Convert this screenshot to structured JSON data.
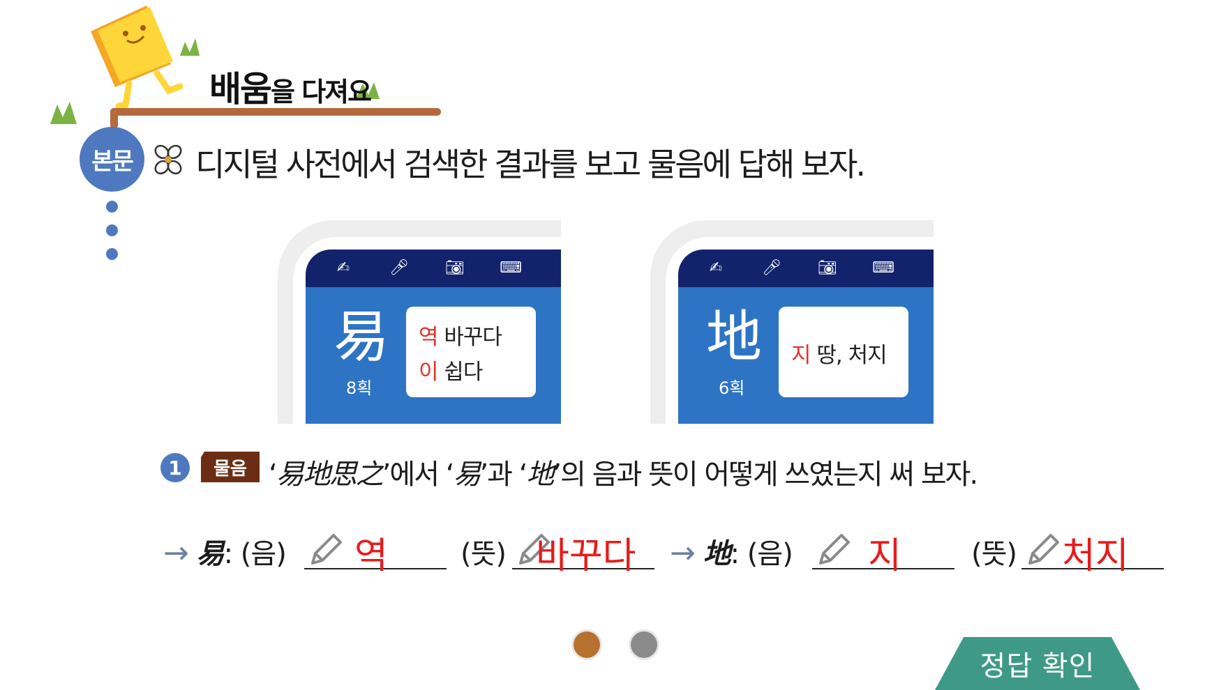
{
  "header": {
    "title_main": "배움",
    "title_rest": "을 다져요"
  },
  "section": {
    "badge": "본문",
    "instruction": "디지털 사전에서 검색한 결과를 보고 물음에 답해 보자."
  },
  "dictionary_cards": [
    {
      "hanja": "易",
      "strokes": "8획",
      "readings": [
        {
          "sound": "역",
          "meaning": "바꾸다"
        },
        {
          "sound": "이",
          "meaning": "쉽다"
        }
      ]
    },
    {
      "hanja": "地",
      "strokes": "6획",
      "readings": [
        {
          "sound": "지",
          "meaning": "땅, 처지"
        }
      ]
    }
  ],
  "question": {
    "number": "1",
    "tag": "물음",
    "text_q1": "‘",
    "text_phrase": "易地思之",
    "text_q2": "’에서 ‘",
    "text_c1": "易",
    "text_q3": "’과 ‘",
    "text_c2": "地",
    "text_q4": "’의 음과 뜻이 어떻게 쓰였는지 써 보자."
  },
  "answers": {
    "arrow": "→",
    "items": [
      {
        "char": "易",
        "sound_label": "(음)",
        "sound": "역",
        "meaning_label": "(뜻)",
        "meaning": "바꾸다"
      },
      {
        "char": "地",
        "sound_label": "(음)",
        "sound": "지",
        "meaning_label": "(뜻)",
        "meaning": "처지"
      }
    ]
  },
  "pagination": {
    "total": 2,
    "current": 1,
    "active_color": "#b8702e",
    "inactive_color": "#8a8a8a"
  },
  "check_button": {
    "label": "정답 확인"
  },
  "colors": {
    "accent_blue": "#4e79c0",
    "answer_red": "#e81b1b",
    "banner_brown": "#b46a3d",
    "button_green": "#3e9a86"
  }
}
